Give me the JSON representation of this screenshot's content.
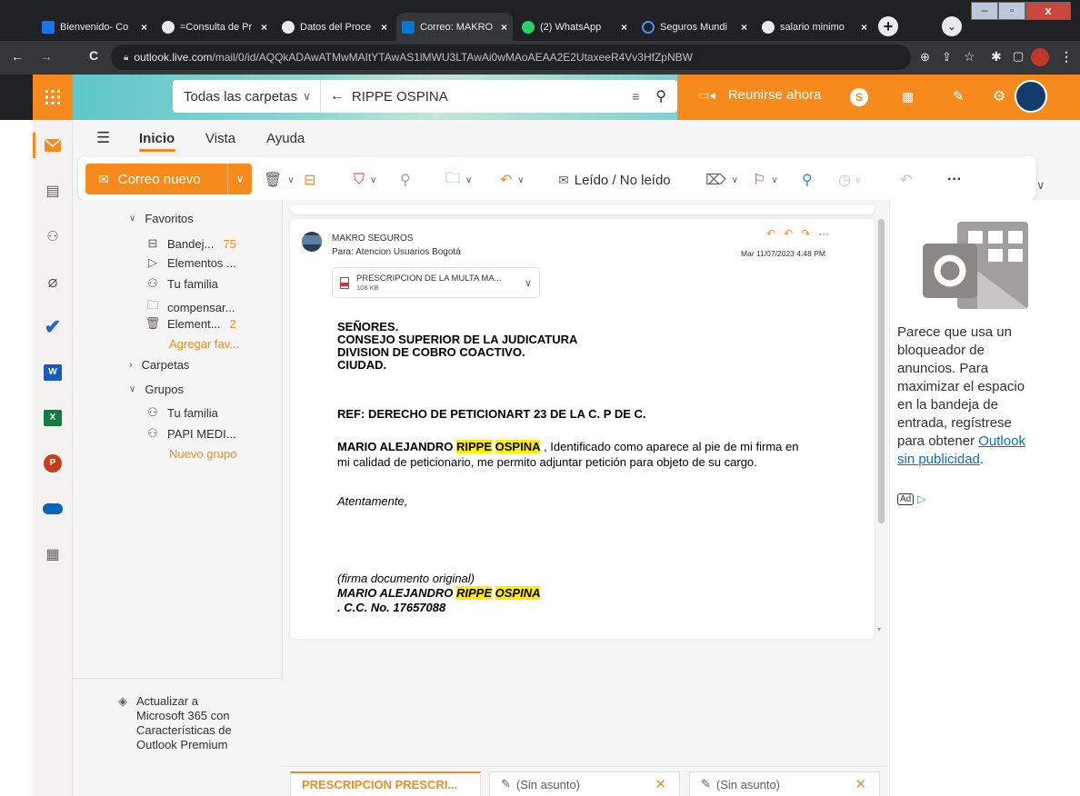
{
  "browser": {
    "tabs": [
      {
        "title": "Bienvenido- Co",
        "icon": "document-icon",
        "color": "#1a73e8"
      },
      {
        "title": "=Consulta de Pr",
        "icon": "globe-icon",
        "color": "#e8eaed"
      },
      {
        "title": "Datos del Proce",
        "icon": "globe-icon",
        "color": "#e8eaed"
      },
      {
        "title": "Correo: MAKRO",
        "icon": "outlook-icon",
        "color": "#0078d4"
      },
      {
        "title": "(2) WhatsApp",
        "icon": "whatsapp-icon",
        "color": "#25d366"
      },
      {
        "title": "Seguros Mundi",
        "icon": "loading-icon",
        "color": "#4f8ef7"
      },
      {
        "title": "salario minimo",
        "icon": "google-icon",
        "color": "#e8eaed"
      }
    ],
    "url_host": "outlook.live.com",
    "url_path": "/mail/0/id/AQQkADAwATMwMAItYTAwAS1lMWU3LTAwAi0wMAoAEAA2E2UtaxeeR4Vv3HfZpNBW"
  },
  "header": {
    "folder_scope": "Todas las carpetas",
    "search_query": "RIPPE OSPINA",
    "meet_now": "Reunirse ahora"
  },
  "nav": {
    "tabs": [
      "Inicio",
      "Vista",
      "Ayuda"
    ]
  },
  "ribbon": {
    "new_mail": "Correo nuevo",
    "read_unread": "Leído / No leído"
  },
  "folders": {
    "favorites_label": "Favoritos",
    "favorites": [
      {
        "label": "Bandej...",
        "count": "75",
        "icon": "inbox-icon"
      },
      {
        "label": "Elementos ...",
        "count": "",
        "icon": "send-icon"
      },
      {
        "label": "Tu familia",
        "count": "",
        "icon": "group-icon"
      },
      {
        "label": "compensar...",
        "count": "",
        "icon": "folder-icon"
      },
      {
        "label": "Element...",
        "count": "2",
        "icon": "trash-icon"
      }
    ],
    "add_favorite": "Agregar fav...",
    "folders_label": "Carpetas",
    "groups_label": "Grupos",
    "groups": [
      {
        "label": "Tu familia",
        "icon": "group-icon"
      },
      {
        "label": "PAPI MEDI...",
        "icon": "group-icon"
      }
    ],
    "new_group": "Nuevo grupo",
    "upgrade_text": "Actualizar a Microsoft 365 con Características de Outlook Premium"
  },
  "message": {
    "sender": "MAKRO SEGUROS",
    "to": "Para: Atencion Usuarios Bogotá",
    "date": "Mar 11/07/2023 4:48 PM",
    "attachment_name": "PRESCRIPCION DE LA MULTA MA...",
    "attachment_size": "108 KB",
    "line1": "SEÑORES.",
    "line2": "CONSEJO SUPERIOR DE LA JUDICATURA",
    "line3": "DIVISION DE COBRO COACTIVO.",
    "line4": "CIUDAD.",
    "ref": "REF: DERECHO DE PETICIONART 23 DE LA C. P DE C.",
    "name_first": "MARIO ALEJANDRO",
    "name_hl1": "RIPPE",
    "name_hl2": "OSPINA",
    "body_rest1": " , Identificado como aparece al pie de mi firma en",
    "body_rest2": "mi calidad de peticionario, me permito adjuntar petición para objeto de su cargo.",
    "closing": "Atentamente,",
    "signature_note": "(firma documento original)",
    "sig_first": "MARIO ALEJANDRO",
    "sig_hl1": "RIPPE",
    "sig_hl2": "OSPINA",
    "cc": ". C.C. No. 17657088"
  },
  "ad": {
    "text": "Parece que usa un bloqueador de anuncios. Para maximizar el espacio en la bandeja de entrada, regístrese para obtener",
    "link": "Outlook sin publicidad",
    "after_link": ".",
    "badge": "Ad"
  },
  "draft_tabs": [
    {
      "label": "PRESCRIPCION PRESCRI..."
    },
    {
      "label": "(Sin asunto)"
    },
    {
      "label": "(Sin asunto)"
    }
  ],
  "colors": {
    "accent": "#f78a1c",
    "highlight": "#ffee00"
  }
}
